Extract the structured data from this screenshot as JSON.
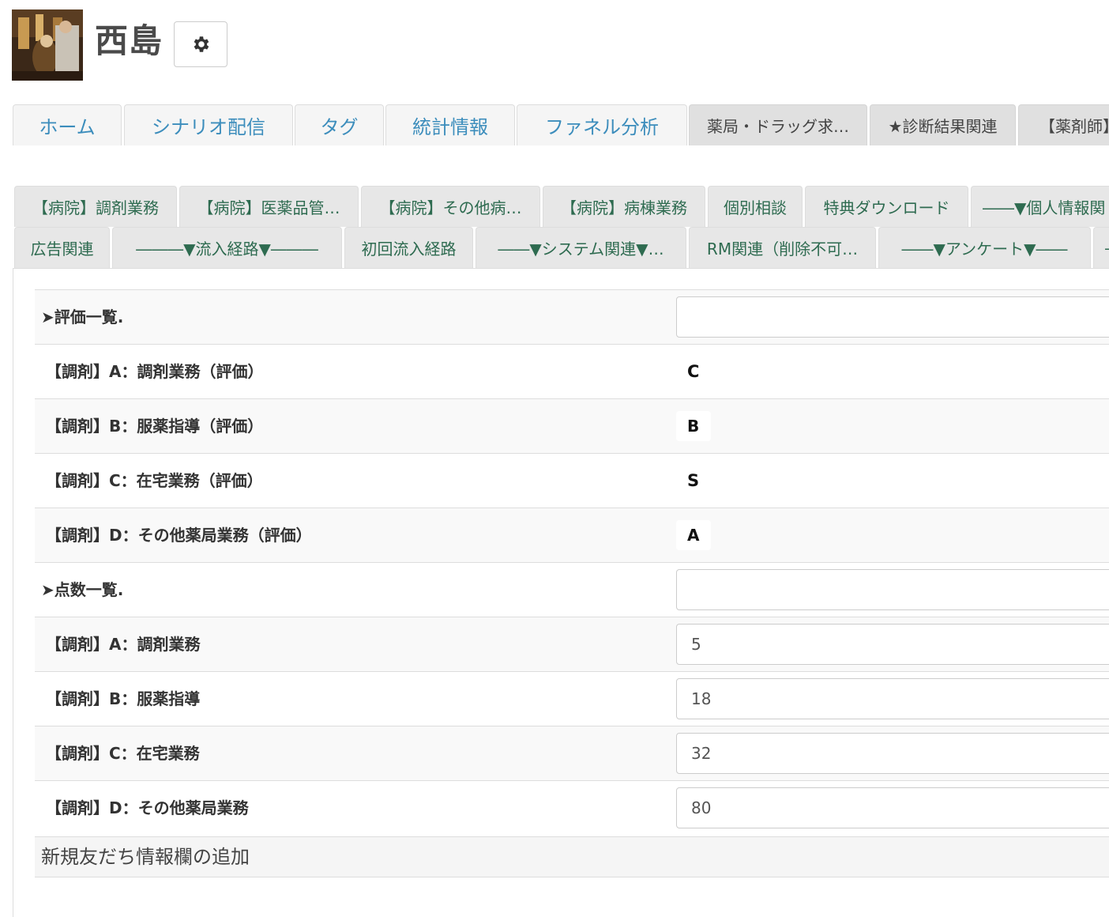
{
  "header": {
    "user_name": "西島"
  },
  "icons": {
    "settings": "gear-icon",
    "avatar": "user-avatar-photo"
  },
  "main_tabs": [
    {
      "label": "ホーム",
      "style": "link"
    },
    {
      "label": "シナリオ配信",
      "style": "link"
    },
    {
      "label": "タグ",
      "style": "link"
    },
    {
      "label": "統計情報",
      "style": "link"
    },
    {
      "label": "ファネル分析",
      "style": "link"
    },
    {
      "label": "薬局・ドラッグ求…",
      "style": "dark"
    },
    {
      "label": "★診断結果関連",
      "style": "dark"
    },
    {
      "label": "【薬剤師】",
      "style": "dark"
    }
  ],
  "sub_tabs_row1": [
    {
      "label": "【病院】調剤業務"
    },
    {
      "label": "【病院】医薬品管…"
    },
    {
      "label": "【病院】その他病…"
    },
    {
      "label": "【病院】病棟業務"
    },
    {
      "label": "個別相談"
    },
    {
      "label": "特典ダウンロード"
    },
    {
      "label": "――▼個人情報関"
    }
  ],
  "sub_tabs_row2": [
    {
      "label": "広告関連"
    },
    {
      "label": "―――▼流入経路▼―――"
    },
    {
      "label": "初回流入経路"
    },
    {
      "label": "――▼システム関連▼…"
    },
    {
      "label": "RM関連（削除不可…"
    },
    {
      "label": "――▼アンケート▼――"
    },
    {
      "label": "―"
    }
  ],
  "fields": {
    "evaluation_header": {
      "label": "➤評価一覧.",
      "value": ""
    },
    "eval_a": {
      "label": "【調剤】A：調剤業務（評価）",
      "value": "C"
    },
    "eval_b": {
      "label": "【調剤】B：服薬指導（評価）",
      "value": "B"
    },
    "eval_c": {
      "label": "【調剤】C：在宅業務（評価）",
      "value": "S"
    },
    "eval_d": {
      "label": "【調剤】D：その他薬局業務（評価）",
      "value": "A"
    },
    "score_header": {
      "label": "➤点数一覧.",
      "value": ""
    },
    "score_a": {
      "label": "【調剤】A：調剤業務",
      "value": "5"
    },
    "score_b": {
      "label": "【調剤】B：服薬指導",
      "value": "18"
    },
    "score_c": {
      "label": "【調剤】C：在宅業務",
      "value": "32"
    },
    "score_d": {
      "label": "【調剤】D：その他薬局業務",
      "value": "80"
    }
  },
  "add_field_label": "新規友だち情報欄の追加",
  "colors": {
    "link_blue": "#3c8dbc",
    "sub_tab_green": "#2e6b50",
    "tab_bg": "#f5f5f5",
    "dark_tab_bg": "#e0e0e0"
  }
}
